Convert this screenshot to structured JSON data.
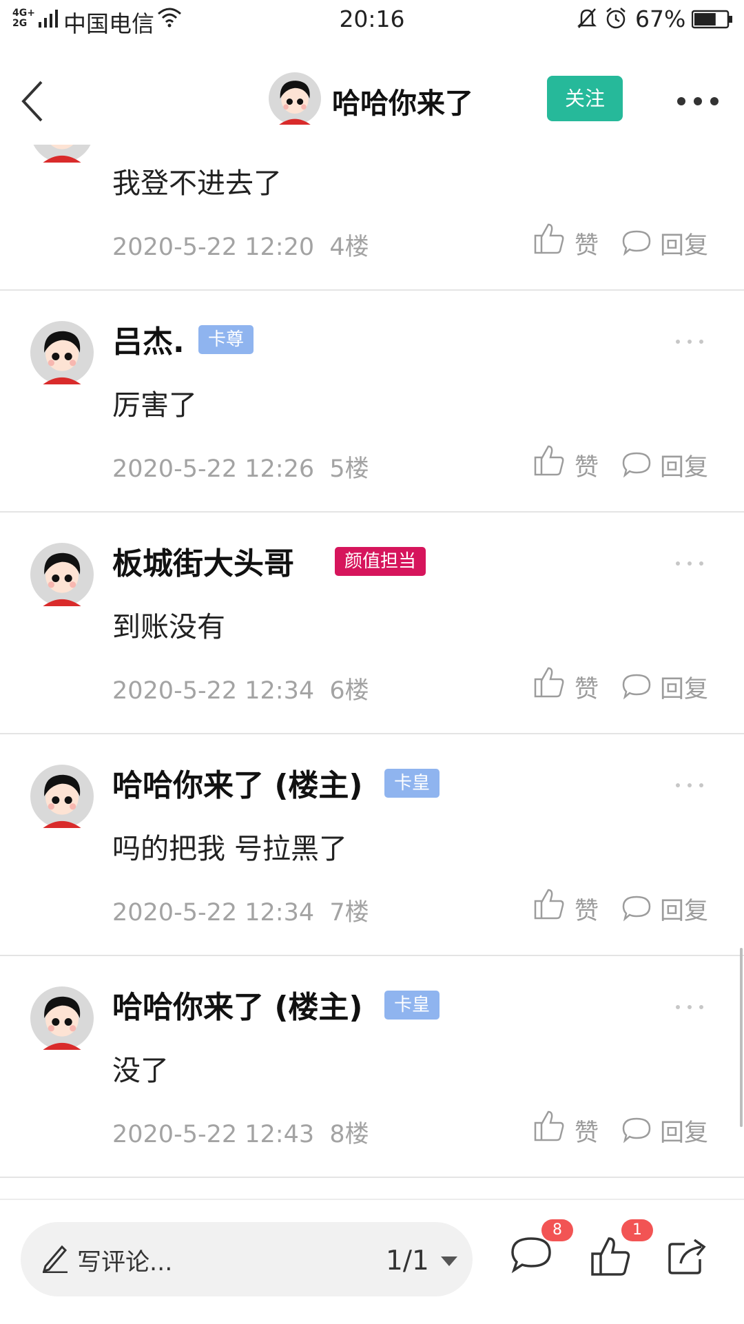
{
  "status_bar": {
    "network_top": "4G+",
    "network_bottom": "2G",
    "carrier": "中国电信",
    "time": "20:16",
    "battery_pct": "67%",
    "battery_level": 0.67
  },
  "header": {
    "title": "哈哈你来了",
    "follow_label": "关注"
  },
  "posts": [
    {
      "content": "我登不进去了",
      "date": "2020-5-22 12:20",
      "floor": "4楼",
      "like_label": "赞",
      "reply_label": "回复"
    },
    {
      "username": "吕杰.",
      "badge": "卡尊",
      "content": "厉害了",
      "date": "2020-5-22 12:26",
      "floor": "5楼",
      "like_label": "赞",
      "reply_label": "回复"
    },
    {
      "username": "板城街大头哥",
      "badge": "颜值担当",
      "content": "到账没有",
      "date": "2020-5-22 12:34",
      "floor": "6楼",
      "like_label": "赞",
      "reply_label": "回复"
    },
    {
      "username": "哈哈你来了 (楼主)",
      "badge": "卡皇",
      "content": "吗的把我 号拉黑了",
      "date": "2020-5-22 12:34",
      "floor": "7楼",
      "like_label": "赞",
      "reply_label": "回复"
    },
    {
      "username": "哈哈你来了 (楼主)",
      "badge": "卡皇",
      "content": "没了",
      "date": "2020-5-22 12:43",
      "floor": "8楼",
      "like_label": "赞",
      "reply_label": "回复"
    }
  ],
  "bottom_bar": {
    "placeholder": "写评论...",
    "page_indicator": "1/1",
    "comment_count": "8",
    "like_count": "1"
  },
  "colors": {
    "accent": "#26b99a",
    "badge_blue": "#8fb4ef",
    "badge_red": "#d6155c",
    "count_badge": "#f25454"
  }
}
